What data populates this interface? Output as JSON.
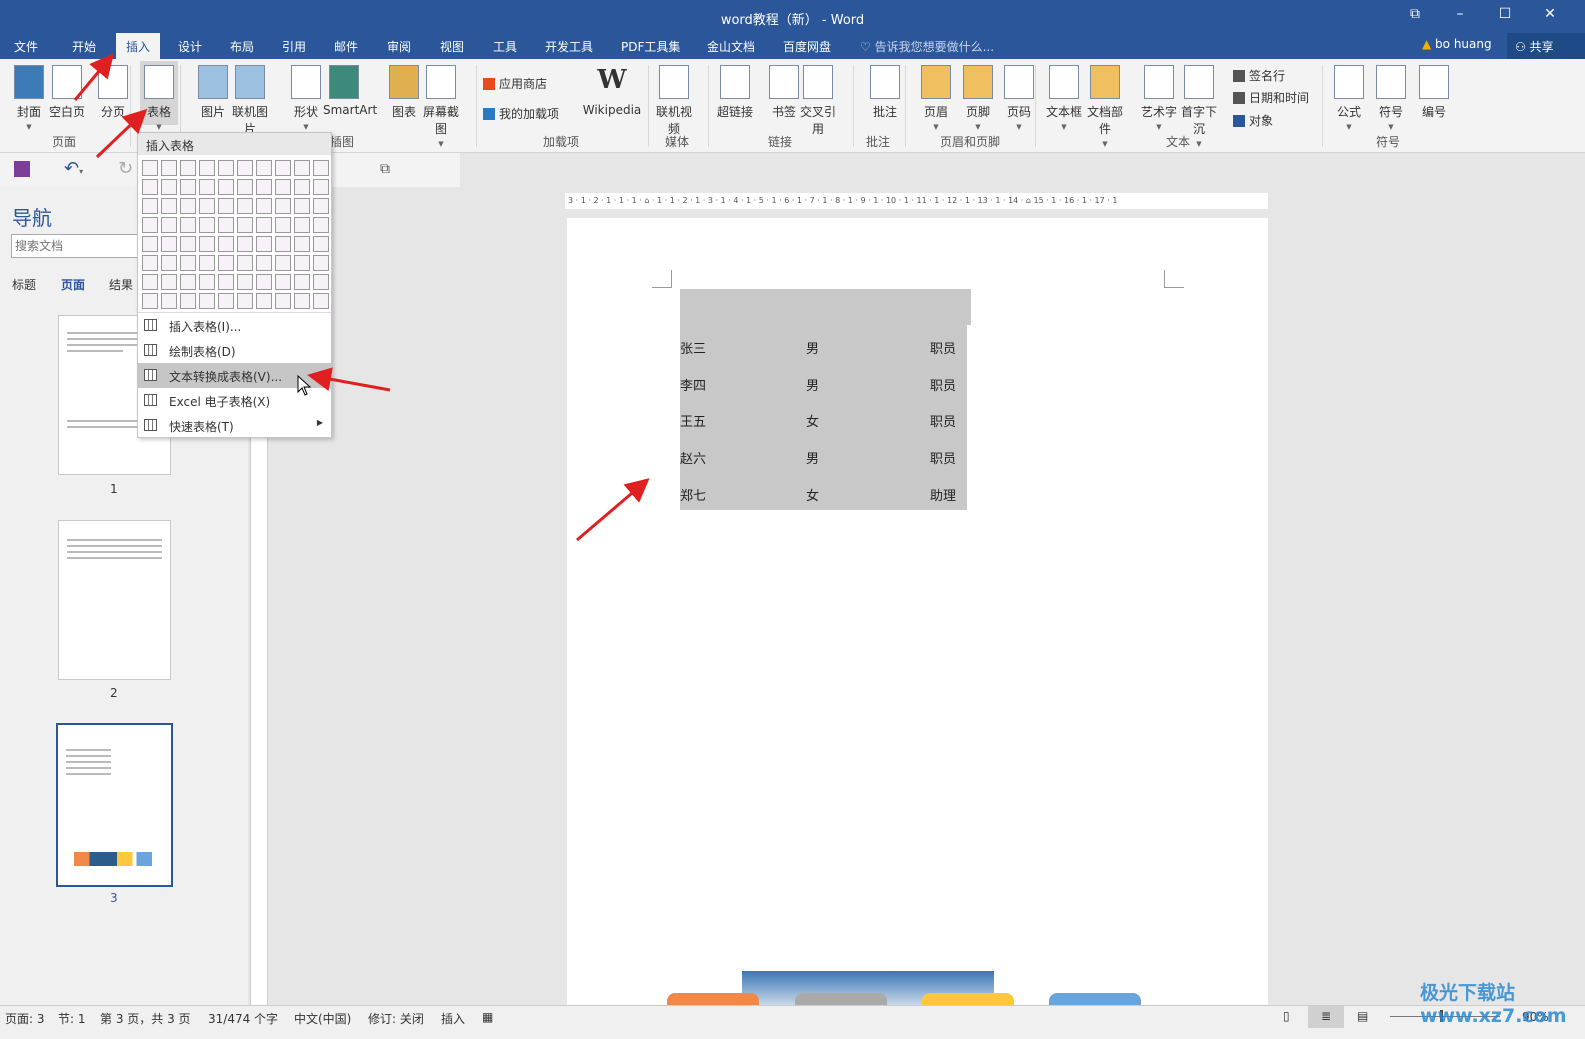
{
  "window": {
    "title": "word教程（新） - Word",
    "controls": [
      "⧉",
      "–",
      "☐",
      "✕"
    ]
  },
  "tabs": [
    "文件",
    "开始",
    "插入",
    "设计",
    "布局",
    "引用",
    "邮件",
    "审阅",
    "视图",
    "工具",
    "开发工具",
    "PDF工具集",
    "金山文档",
    "百度网盘"
  ],
  "active_tab": "插入",
  "tell_me": "告诉我您想要做什么...",
  "user": "bo huang",
  "share": "共享",
  "ribbon": {
    "buttons": [
      "封面",
      "空白页",
      "分页",
      "表格",
      "图片",
      "联机图片",
      "形状",
      "SmartArt",
      "图表",
      "屏幕截图",
      "Wikipedia",
      "联机视频",
      "超链接",
      "书签",
      "交叉引用",
      "批注",
      "页眉",
      "页脚",
      "页码",
      "文本框",
      "文档部件",
      "艺术字",
      "首字下沉",
      "公式",
      "符号",
      "编号"
    ],
    "small": [
      "应用商店",
      "我的加载项",
      "签名行",
      "日期和时间",
      "对象"
    ],
    "groups": [
      "页面",
      "表格",
      "插图",
      "加载项",
      "媒体",
      "链接",
      "批注",
      "页眉和页脚",
      "文本",
      "符号"
    ]
  },
  "nav": {
    "title": "导航",
    "search_placeholder": "搜索文档",
    "tabs": [
      "标题",
      "页面",
      "结果"
    ],
    "pages": [
      "1",
      "2",
      "3"
    ]
  },
  "menu": {
    "header": "插入表格",
    "items": [
      "插入表格(I)...",
      "绘制表格(D)",
      "文本转换成表格(V)...",
      "Excel 电子表格(X)",
      "快速表格(T)"
    ],
    "highlighted": "文本转换成表格(V)..."
  },
  "ruler": "3 · 1 · 2 · 1 · 1 · 1 · ⌂ · 1 · 1 · 2 · 1 · 3 · 1 · 4 · 1 · 5 · 1 · 6 · 1 · 7 · 1 · 8 · 1 · 9 · 1 · 10 · 1 · 11 · 1 · 12 · 1 · 13 · 1 · 14 · ⌂ 15 · 1 · 16 · 1 · 17 · 1",
  "table": [
    [
      "张三",
      "男",
      "职员"
    ],
    [
      "李四",
      "男",
      "职员"
    ],
    [
      "王五",
      "女",
      "职员"
    ],
    [
      "赵六",
      "男",
      "职员"
    ],
    [
      "郑七",
      "女",
      "助理"
    ]
  ],
  "status": [
    "页面: 3",
    "节: 1",
    "第 3 页，共 3 页",
    "31/474 个字",
    "中文(中国)",
    "修订: 关闭",
    "插入"
  ],
  "zoom": "90%",
  "watermark": "极光下载站 www.xz7.com",
  "colors": {
    "brand": "#2b579a",
    "arrow": "#e02020"
  }
}
